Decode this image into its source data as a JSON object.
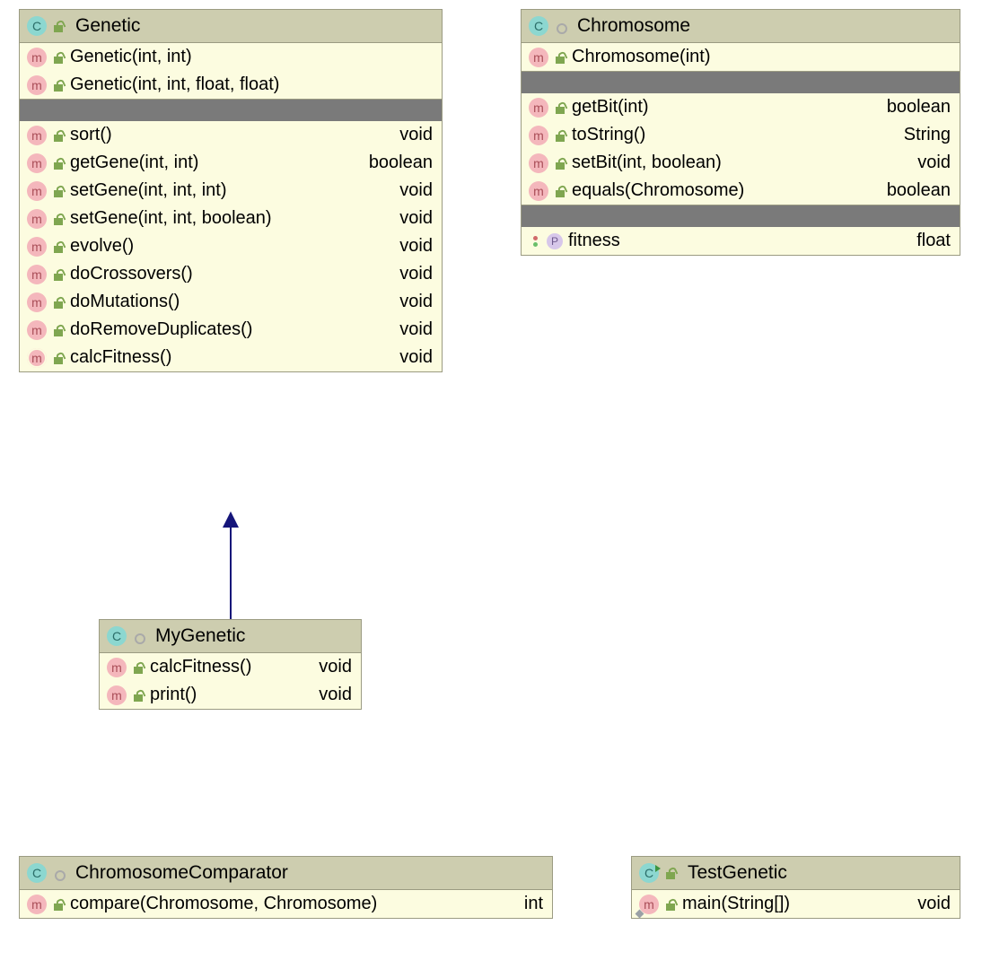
{
  "classes": {
    "genetic": {
      "name": "Genetic",
      "constructors": [
        {
          "sig": "Genetic(int, int)"
        },
        {
          "sig": "Genetic(int, int, float, float)"
        }
      ],
      "methods": [
        {
          "sig": "sort()",
          "ret": "void"
        },
        {
          "sig": "getGene(int, int)",
          "ret": "boolean"
        },
        {
          "sig": "setGene(int, int, int)",
          "ret": "void"
        },
        {
          "sig": "setGene(int, int, boolean)",
          "ret": "void"
        },
        {
          "sig": "evolve()",
          "ret": "void"
        },
        {
          "sig": "doCrossovers()",
          "ret": "void"
        },
        {
          "sig": "doMutations()",
          "ret": "void"
        },
        {
          "sig": "doRemoveDuplicates()",
          "ret": "void"
        },
        {
          "sig": "calcFitness()",
          "ret": "void",
          "abstract": true
        }
      ]
    },
    "chromosome": {
      "name": "Chromosome",
      "constructors": [
        {
          "sig": "Chromosome(int)"
        }
      ],
      "methods": [
        {
          "sig": "getBit(int)",
          "ret": "boolean"
        },
        {
          "sig": "toString()",
          "ret": "String"
        },
        {
          "sig": "setBit(int, boolean)",
          "ret": "void"
        },
        {
          "sig": "equals(Chromosome)",
          "ret": "boolean"
        }
      ],
      "fields": [
        {
          "sig": "fitness",
          "ret": "float"
        }
      ]
    },
    "mygenetic": {
      "name": "MyGenetic",
      "methods": [
        {
          "sig": "calcFitness()",
          "ret": "void"
        },
        {
          "sig": "print()",
          "ret": "void"
        }
      ]
    },
    "chromcomp": {
      "name": "ChromosomeComparator",
      "methods": [
        {
          "sig": "compare(Chromosome, Chromosome)",
          "ret": "int"
        }
      ]
    },
    "testgenetic": {
      "name": "TestGenetic",
      "methods": [
        {
          "sig": "main(String[])",
          "ret": "void",
          "static": true
        }
      ]
    }
  }
}
